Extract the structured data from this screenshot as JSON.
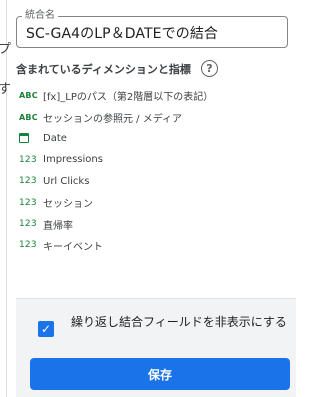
{
  "behind": {
    "peek_1": "プ",
    "peek_2": "す"
  },
  "name_field": {
    "label": "統合名",
    "value": "SC-GA4のLP＆DATEでの結合"
  },
  "section": {
    "title": "含まれているディメンションと指標",
    "help_icon": "help-circle-icon"
  },
  "fields": [
    {
      "type": "ABC",
      "name": "[fx]_LPのパス（第2階層以下の表記）"
    },
    {
      "type": "ABC",
      "name": "セッションの参照元 / メディア"
    },
    {
      "type": "calendar",
      "name": "Date"
    },
    {
      "type": "123",
      "name": "Impressions"
    },
    {
      "type": "123",
      "name": "Url Clicks"
    },
    {
      "type": "123",
      "name": "セッション"
    },
    {
      "type": "123",
      "name": "直帰率"
    },
    {
      "type": "123",
      "name": "キーイベント"
    }
  ],
  "footer": {
    "checkbox_checked": true,
    "checkbox_label": "繰り返し結合フィールドを非表示にする",
    "save_label": "保存"
  },
  "colors": {
    "accent": "#1a73e8",
    "field_type": "#188038"
  }
}
